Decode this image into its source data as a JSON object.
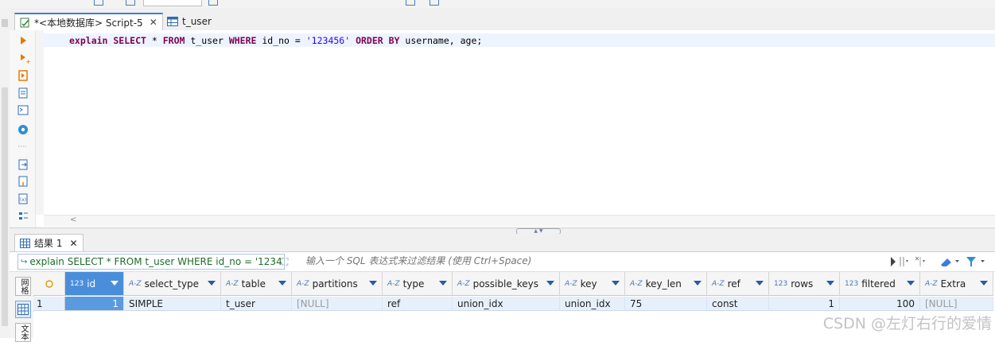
{
  "tabs": [
    {
      "label": "*<本地数据库> Script-5",
      "active": true,
      "closable": true
    },
    {
      "label": "t_user",
      "active": false,
      "closable": false
    }
  ],
  "editor": {
    "line1": [
      {
        "t": "explain SELECT",
        "k": "kw"
      },
      {
        "t": " * ",
        "k": "plain"
      },
      {
        "t": "FROM",
        "k": "kw"
      },
      {
        "t": " t_user ",
        "k": "plain"
      },
      {
        "t": "WHERE",
        "k": "kw"
      },
      {
        "t": " id_no = ",
        "k": "plain"
      },
      {
        "t": "'123456'",
        "k": "str"
      },
      {
        "t": " ",
        "k": "plain"
      },
      {
        "t": "ORDER BY",
        "k": "kw"
      },
      {
        "t": " username, age;",
        "k": "plain"
      }
    ]
  },
  "results": {
    "tab_label": "结果 1",
    "query_text": "explain SELECT * FROM t_user WHERE id_no = '1234",
    "filter_placeholder": "输入一个 SQL 表达式来过滤结果 (使用 Ctrl+Space)",
    "side_tab": "网格",
    "side_tab2": "文本",
    "columns": [
      {
        "type": "123",
        "label": "id"
      },
      {
        "type": "A-Z",
        "label": "select_type"
      },
      {
        "type": "A-Z",
        "label": "table"
      },
      {
        "type": "A-Z",
        "label": "partitions"
      },
      {
        "type": "A-Z",
        "label": "type"
      },
      {
        "type": "A-Z",
        "label": "possible_keys"
      },
      {
        "type": "A-Z",
        "label": "key"
      },
      {
        "type": "A-Z",
        "label": "key_len"
      },
      {
        "type": "A-Z",
        "label": "ref"
      },
      {
        "type": "123",
        "label": "rows"
      },
      {
        "type": "123",
        "label": "filtered"
      },
      {
        "type": "A-Z",
        "label": "Extra"
      }
    ],
    "rows": [
      {
        "num": "1",
        "cells": [
          "1",
          "SIMPLE",
          "t_user",
          "[NULL]",
          "ref",
          "union_idx",
          "union_idx",
          "75",
          "const",
          "1",
          "100",
          "[NULL]"
        ]
      }
    ]
  },
  "watermark": "CSDN @左灯右行的爱情",
  "colors": {
    "accent": "#3b7ddd",
    "selected_header": "#4a8edb",
    "row_bg": "#e6f0fb"
  }
}
